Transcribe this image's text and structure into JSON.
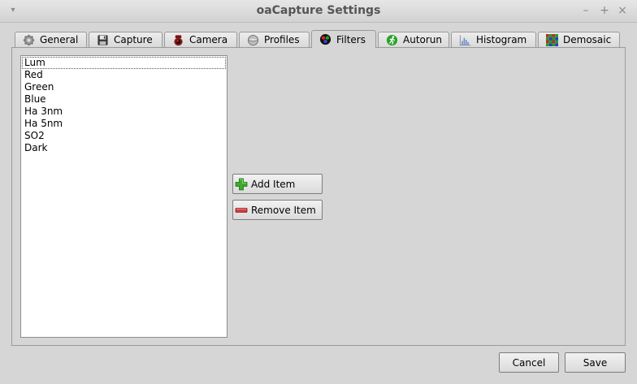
{
  "window": {
    "title": "oaCapture Settings",
    "controls": {
      "minimize": "–",
      "maximize": "+",
      "close": "×",
      "menu": "▾"
    }
  },
  "tabs": [
    {
      "label": "General",
      "icon": "gear-icon"
    },
    {
      "label": "Capture",
      "icon": "floppy-disk-icon"
    },
    {
      "label": "Camera",
      "icon": "camera-icon"
    },
    {
      "label": "Profiles",
      "icon": "profile-disc-icon"
    },
    {
      "label": "Filters",
      "icon": "color-filter-wheel-icon",
      "active": true
    },
    {
      "label": "Autorun",
      "icon": "autorun-runner-icon"
    },
    {
      "label": "Histogram",
      "icon": "histogram-icon"
    },
    {
      "label": "Demosaic",
      "icon": "demosaic-grid-icon"
    }
  ],
  "filters": {
    "items": [
      "Lum",
      "Red",
      "Green",
      "Blue",
      "Ha 3nm",
      "Ha 5nm",
      "SO2",
      "Dark"
    ],
    "current_item": "Lum",
    "add_label": "Add Item",
    "remove_label": "Remove Item"
  },
  "footer": {
    "cancel_label": "Cancel",
    "save_label": "Save"
  },
  "colors": {
    "background": "#d6d6d6",
    "add_green": "#3caa28",
    "remove_red": "#d23c3c"
  }
}
